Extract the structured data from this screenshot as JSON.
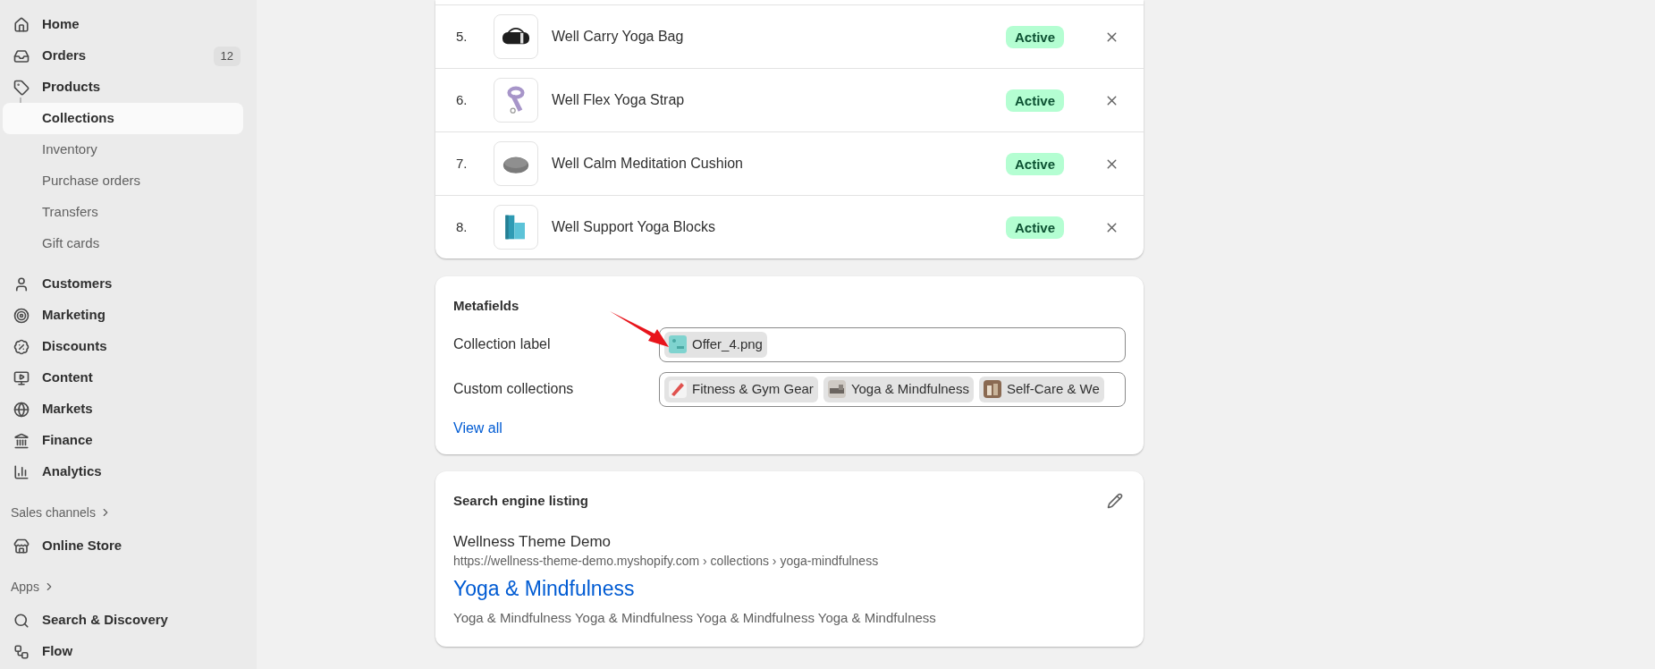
{
  "sidebar": {
    "sections": [
      {
        "items": [
          {
            "label": "Home",
            "selected": false
          },
          {
            "label": "Orders",
            "badge": "12",
            "selected": false
          },
          {
            "label": "Products",
            "selected": false,
            "children": [
              {
                "label": "Collections",
                "selected": true
              },
              {
                "label": "Inventory",
                "selected": false
              },
              {
                "label": "Purchase orders",
                "selected": false
              },
              {
                "label": "Transfers",
                "selected": false
              },
              {
                "label": "Gift cards",
                "selected": false
              }
            ]
          },
          {
            "label": "Customers",
            "selected": false
          },
          {
            "label": "Marketing",
            "selected": false
          },
          {
            "label": "Discounts",
            "selected": false
          },
          {
            "label": "Content",
            "selected": false
          },
          {
            "label": "Markets",
            "selected": false
          },
          {
            "label": "Finance",
            "selected": false
          },
          {
            "label": "Analytics",
            "selected": false
          }
        ]
      },
      {
        "heading": "Sales channels",
        "items": [
          {
            "label": "Online Store",
            "selected": false
          }
        ]
      },
      {
        "heading": "Apps",
        "items": [
          {
            "label": "Search & Discovery",
            "selected": false
          },
          {
            "label": "Flow",
            "selected": false
          }
        ]
      }
    ]
  },
  "products": {
    "rows": [
      {
        "number": "5.",
        "name": "Well Carry Yoga Bag",
        "status": "Active"
      },
      {
        "number": "6.",
        "name": "Well Flex Yoga Strap",
        "status": "Active"
      },
      {
        "number": "7.",
        "name": "Well Calm Meditation Cushion",
        "status": "Active"
      },
      {
        "number": "8.",
        "name": "Well Support Yoga Blocks",
        "status": "Active"
      }
    ]
  },
  "metafields": {
    "title": "Metafields",
    "fields": [
      {
        "label": "Collection label",
        "kind": "file",
        "values": [
          "Offer_4.png"
        ]
      },
      {
        "label": "Custom collections",
        "kind": "references",
        "values": [
          "Fitness & Gym Gear",
          "Yoga & Mindfulness",
          "Self-Care & We"
        ]
      }
    ],
    "link": "View all"
  },
  "seo": {
    "title": "Search engine listing",
    "site_name": "Wellness Theme Demo",
    "url": "https://wellness-theme-demo.myshopify.com › collections › yoga-mindfulness",
    "page_title": "Yoga & Mindfulness",
    "description": "Yoga & Mindfulness Yoga & Mindfulness Yoga & Mindfulness Yoga & Mindfulness"
  }
}
